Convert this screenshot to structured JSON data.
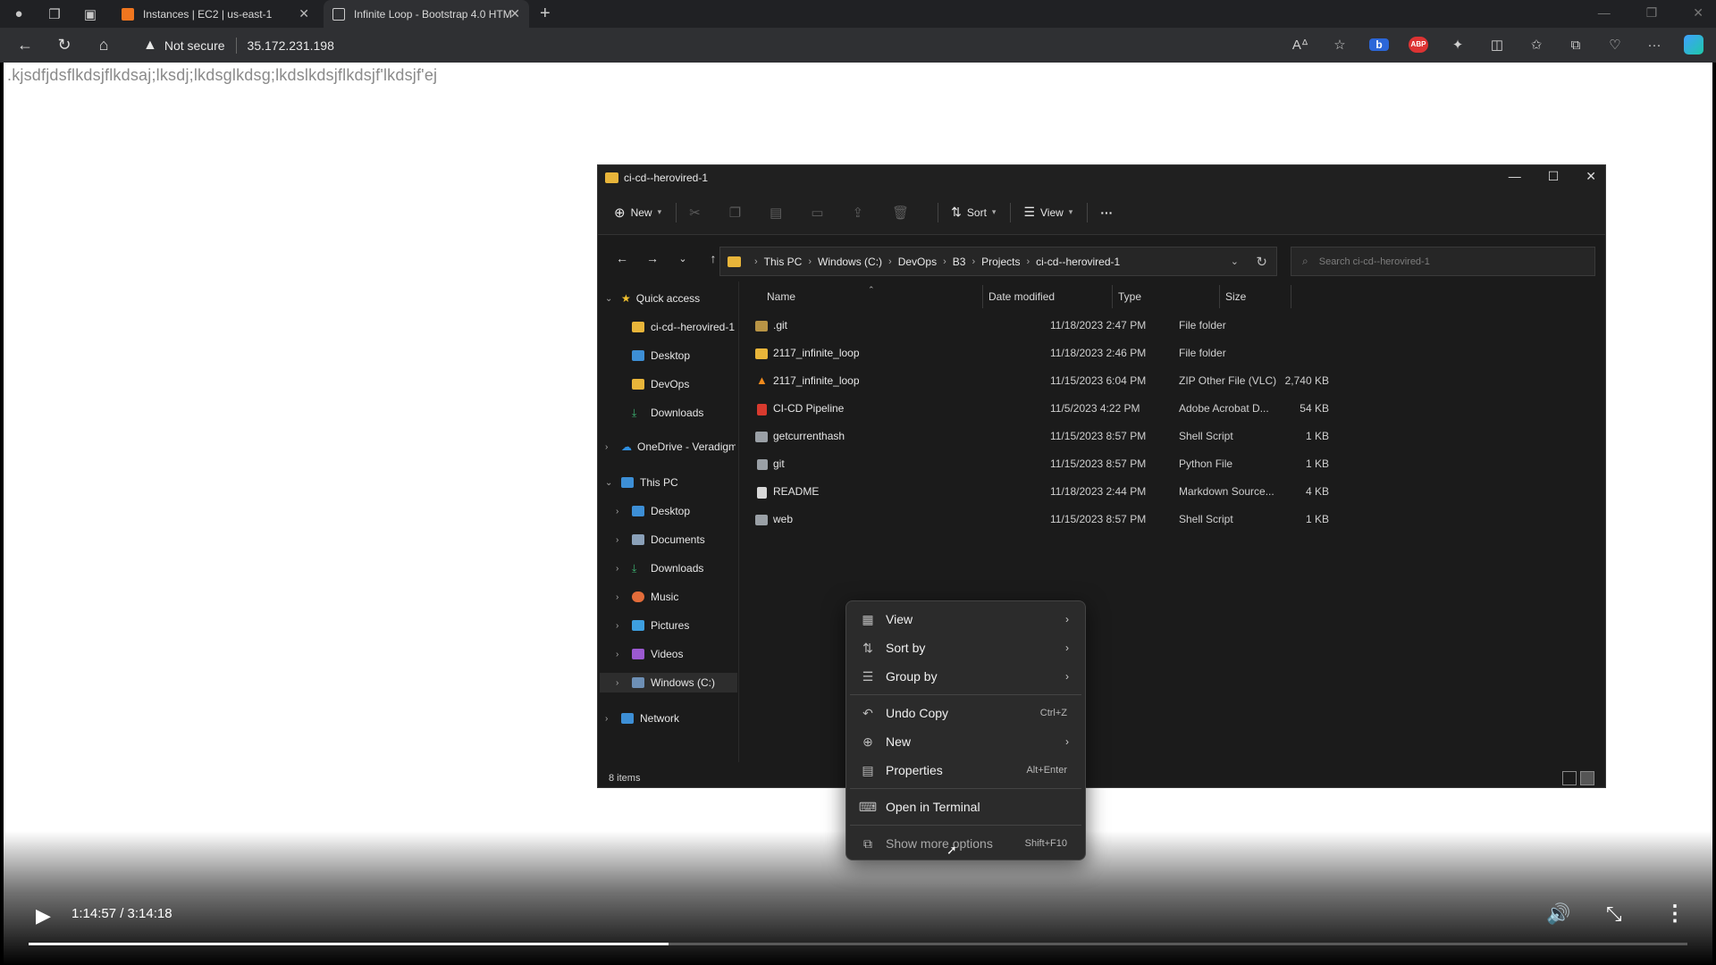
{
  "browser": {
    "tabs": [
      {
        "label": "Instances | EC2 | us-east-1",
        "fav_color": "#f0761f"
      },
      {
        "label": "Infinite Loop - Bootstrap 4.0 HTM",
        "fav_color": "#dddddd"
      }
    ],
    "security_label": "Not secure",
    "url": "35.172.231.198",
    "extension_b": "b",
    "extension_abp": "ABP"
  },
  "page": {
    "text": ".kjsdfjdsflkdsjflkdsaj;lksdj;lkdsglkdsg;lkdslkdsjflkdsjf'lkdsjf'ej"
  },
  "explorer": {
    "title": "ci-cd--herovired-1",
    "commands": {
      "new": "New",
      "sort": "Sort",
      "view": "View",
      "more": "···"
    },
    "breadcrumb": [
      "This PC",
      "Windows (C:)",
      "DevOps",
      "B3",
      "Projects",
      "ci-cd--herovired-1"
    ],
    "search_placeholder": "Search ci-cd--herovired-1",
    "sidebar": [
      {
        "label": "Quick access",
        "icon": "star-icon",
        "color": "#f2c12e"
      },
      {
        "label": "ci-cd--herovired-1",
        "icon": "folder-icon",
        "color": "#e8b53a"
      },
      {
        "label": "Desktop",
        "icon": "desktop-icon",
        "color": "#3d8fd6"
      },
      {
        "label": "DevOps",
        "icon": "folder-icon",
        "color": "#e8b53a"
      },
      {
        "label": "Downloads",
        "icon": "download-icon",
        "color": "#3cb371"
      },
      {
        "label": "OneDrive - Veradigm",
        "icon": "cloud-icon",
        "color": "#2f8fe0"
      },
      {
        "label": "This PC",
        "icon": "pc-icon",
        "color": "#3d8fd6"
      },
      {
        "label": "Desktop",
        "icon": "desktop-icon",
        "color": "#3d8fd6"
      },
      {
        "label": "Documents",
        "icon": "document-icon",
        "color": "#8aa0b8"
      },
      {
        "label": "Downloads",
        "icon": "download-icon",
        "color": "#3cb371"
      },
      {
        "label": "Music",
        "icon": "music-icon",
        "color": "#e36c3a"
      },
      {
        "label": "Pictures",
        "icon": "pictures-icon",
        "color": "#3d9fe0"
      },
      {
        "label": "Videos",
        "icon": "videos-icon",
        "color": "#9b59d0"
      },
      {
        "label": "Windows (C:)",
        "icon": "drive-icon",
        "color": "#6d8fb5"
      },
      {
        "label": "Network",
        "icon": "network-icon",
        "color": "#3d8fd6"
      }
    ],
    "columns": [
      "Name",
      "Date modified",
      "Type",
      "Size"
    ],
    "files": [
      {
        "name": ".git",
        "date": "11/18/2023 2:47 PM",
        "type": "File folder",
        "size": "",
        "icon": "folder-icon",
        "color": "#b89445"
      },
      {
        "name": "2117_infinite_loop",
        "date": "11/18/2023 2:46 PM",
        "type": "File folder",
        "size": "",
        "icon": "folder-icon",
        "color": "#e8b53a"
      },
      {
        "name": "2117_infinite_loop",
        "date": "11/15/2023 6:04 PM",
        "type": "ZIP Other File (VLC)",
        "size": "2,740 KB",
        "icon": "vlc-icon",
        "color": "#f08a1c"
      },
      {
        "name": "CI-CD Pipeline",
        "date": "11/5/2023 4:22 PM",
        "type": "Adobe Acrobat D...",
        "size": "54 KB",
        "icon": "pdf-icon",
        "color": "#d83a2e"
      },
      {
        "name": "getcurrenthash",
        "date": "11/15/2023 8:57 PM",
        "type": "Shell Script",
        "size": "1 KB",
        "icon": "script-icon",
        "color": "#9aa0a6"
      },
      {
        "name": "git",
        "date": "11/15/2023 8:57 PM",
        "type": "Python File",
        "size": "1 KB",
        "icon": "python-icon",
        "color": "#9aa0a6"
      },
      {
        "name": "README",
        "date": "11/18/2023 2:44 PM",
        "type": "Markdown Source...",
        "size": "4 KB",
        "icon": "markdown-icon",
        "color": "#d8d8d8"
      },
      {
        "name": "web",
        "date": "11/15/2023 8:57 PM",
        "type": "Shell Script",
        "size": "1 KB",
        "icon": "script-icon",
        "color": "#9aa0a6"
      }
    ],
    "status": "8 items"
  },
  "context_menu": {
    "items": [
      {
        "label": "View",
        "shortcut": "",
        "icon": "grid-icon",
        "submenu": true
      },
      {
        "label": "Sort by",
        "shortcut": "",
        "icon": "sort-icon",
        "submenu": true
      },
      {
        "label": "Group by",
        "shortcut": "",
        "icon": "group-icon",
        "submenu": true
      },
      {
        "label": "Undo Copy",
        "shortcut": "Ctrl+Z",
        "icon": "undo-icon",
        "submenu": false
      },
      {
        "label": "New",
        "shortcut": "",
        "icon": "plus-circle-icon",
        "submenu": true
      },
      {
        "label": "Properties",
        "shortcut": "Alt+Enter",
        "icon": "properties-icon",
        "submenu": false
      },
      {
        "label": "Open in Terminal",
        "shortcut": "",
        "icon": "terminal-icon",
        "submenu": false
      },
      {
        "label": "Show more options",
        "shortcut": "Shift+F10",
        "icon": "more-options-icon",
        "submenu": false
      }
    ]
  },
  "player": {
    "time": "1:14:57 / 3:14:18",
    "progress_fraction": 0.386
  }
}
